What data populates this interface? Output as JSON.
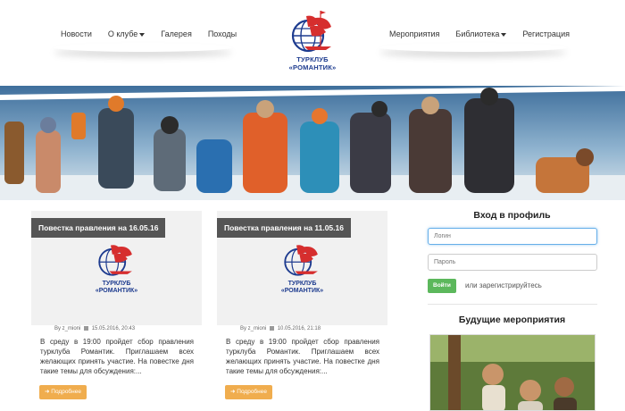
{
  "nav_left": [
    {
      "label": "Новости",
      "caret": false
    },
    {
      "label": "О клубе",
      "caret": true
    },
    {
      "label": "Галерея",
      "caret": false
    },
    {
      "label": "Походы",
      "caret": false
    }
  ],
  "nav_right": [
    {
      "label": "Мероприятия",
      "caret": false
    },
    {
      "label": "Библиотека",
      "caret": true
    },
    {
      "label": "Регистрация",
      "caret": false
    }
  ],
  "logo": {
    "line1": "ТУРКЛУБ",
    "line2": "«РОМАНТИК»"
  },
  "cards": [
    {
      "title": "Повестка правления на 16.05.16",
      "logo_line1": "ТУРКЛУБ",
      "logo_line2": "«РОМАНТИК»",
      "author": "By z_mioni",
      "date": "15.05.2016, 20:43",
      "text": "В среду в 19:00 пройдет сбор правления турклуба Романтик. Приглашаем всех желающих принять участие. На повестке дня такие темы для обсуждения:...",
      "button": "Подробнее"
    },
    {
      "title": "Повестка правления на 11.05.16",
      "logo_line1": "ТУРКЛУБ",
      "logo_line2": "«РОМАНТИК»",
      "author": "By z_mioni",
      "date": "10.05.2016, 21:18",
      "text": "В среду в 19:00 пройдет сбор правления турклуба Романтик. Приглашаем всех желающих принять участие. На повестке дня такие темы для обсуждения:...",
      "button": "Подробнее"
    }
  ],
  "sidebar": {
    "login_title": "Вход в профиль",
    "login_placeholder": "Логин",
    "password_placeholder": "Пароль",
    "login_button": "Войти",
    "or_register": "или зарегистрируйтесь",
    "events_title": "Будущие мероприятия"
  },
  "colors": {
    "logo_blue": "#1d3b8f",
    "sail_red": "#d62e2e",
    "card_title_bg": "#555555",
    "more_button": "#f0ad4e",
    "login_button": "#5cb85c"
  }
}
